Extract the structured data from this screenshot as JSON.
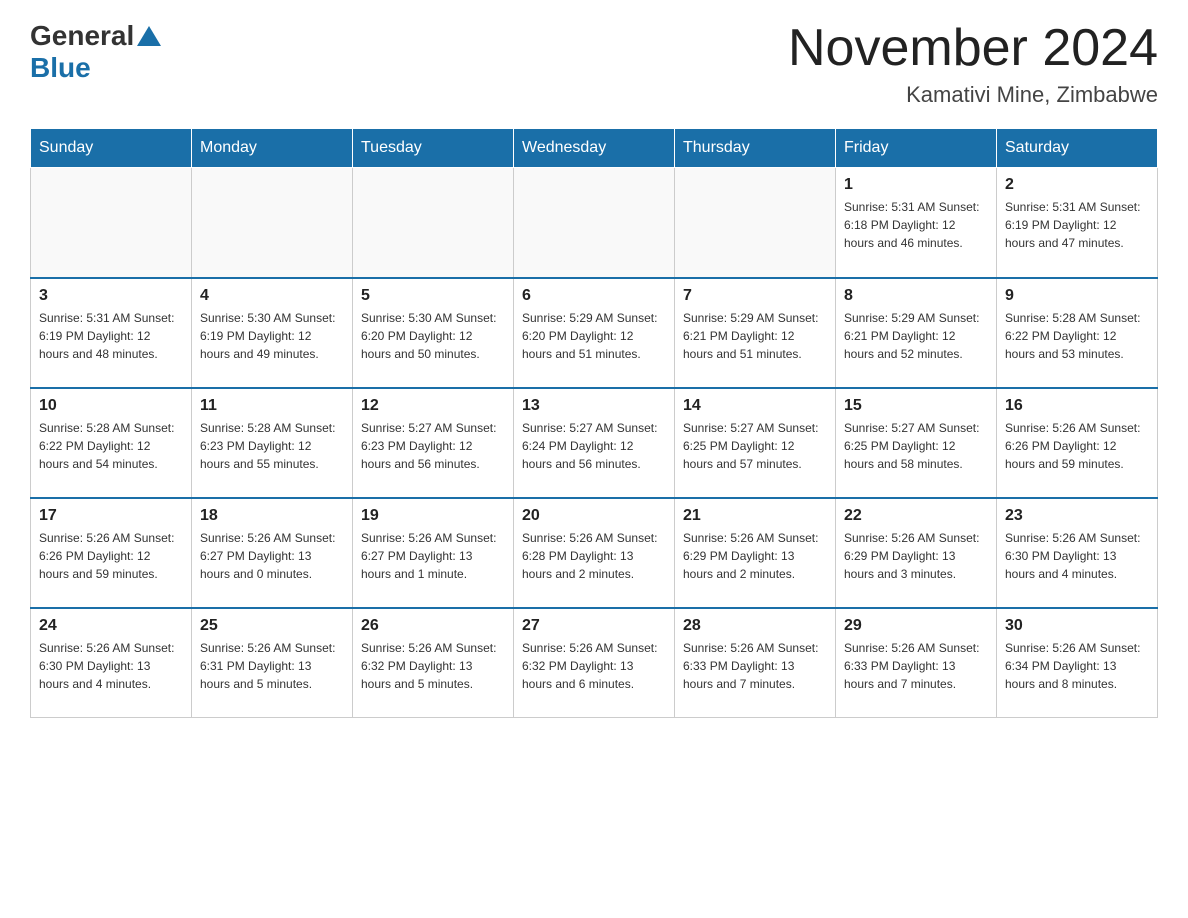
{
  "header": {
    "logo_general": "General",
    "logo_blue": "Blue",
    "month_title": "November 2024",
    "location": "Kamativi Mine, Zimbabwe"
  },
  "days_of_week": [
    "Sunday",
    "Monday",
    "Tuesday",
    "Wednesday",
    "Thursday",
    "Friday",
    "Saturday"
  ],
  "weeks": [
    [
      {
        "day": "",
        "info": ""
      },
      {
        "day": "",
        "info": ""
      },
      {
        "day": "",
        "info": ""
      },
      {
        "day": "",
        "info": ""
      },
      {
        "day": "",
        "info": ""
      },
      {
        "day": "1",
        "info": "Sunrise: 5:31 AM\nSunset: 6:18 PM\nDaylight: 12 hours\nand 46 minutes."
      },
      {
        "day": "2",
        "info": "Sunrise: 5:31 AM\nSunset: 6:19 PM\nDaylight: 12 hours\nand 47 minutes."
      }
    ],
    [
      {
        "day": "3",
        "info": "Sunrise: 5:31 AM\nSunset: 6:19 PM\nDaylight: 12 hours\nand 48 minutes."
      },
      {
        "day": "4",
        "info": "Sunrise: 5:30 AM\nSunset: 6:19 PM\nDaylight: 12 hours\nand 49 minutes."
      },
      {
        "day": "5",
        "info": "Sunrise: 5:30 AM\nSunset: 6:20 PM\nDaylight: 12 hours\nand 50 minutes."
      },
      {
        "day": "6",
        "info": "Sunrise: 5:29 AM\nSunset: 6:20 PM\nDaylight: 12 hours\nand 51 minutes."
      },
      {
        "day": "7",
        "info": "Sunrise: 5:29 AM\nSunset: 6:21 PM\nDaylight: 12 hours\nand 51 minutes."
      },
      {
        "day": "8",
        "info": "Sunrise: 5:29 AM\nSunset: 6:21 PM\nDaylight: 12 hours\nand 52 minutes."
      },
      {
        "day": "9",
        "info": "Sunrise: 5:28 AM\nSunset: 6:22 PM\nDaylight: 12 hours\nand 53 minutes."
      }
    ],
    [
      {
        "day": "10",
        "info": "Sunrise: 5:28 AM\nSunset: 6:22 PM\nDaylight: 12 hours\nand 54 minutes."
      },
      {
        "day": "11",
        "info": "Sunrise: 5:28 AM\nSunset: 6:23 PM\nDaylight: 12 hours\nand 55 minutes."
      },
      {
        "day": "12",
        "info": "Sunrise: 5:27 AM\nSunset: 6:23 PM\nDaylight: 12 hours\nand 56 minutes."
      },
      {
        "day": "13",
        "info": "Sunrise: 5:27 AM\nSunset: 6:24 PM\nDaylight: 12 hours\nand 56 minutes."
      },
      {
        "day": "14",
        "info": "Sunrise: 5:27 AM\nSunset: 6:25 PM\nDaylight: 12 hours\nand 57 minutes."
      },
      {
        "day": "15",
        "info": "Sunrise: 5:27 AM\nSunset: 6:25 PM\nDaylight: 12 hours\nand 58 minutes."
      },
      {
        "day": "16",
        "info": "Sunrise: 5:26 AM\nSunset: 6:26 PM\nDaylight: 12 hours\nand 59 minutes."
      }
    ],
    [
      {
        "day": "17",
        "info": "Sunrise: 5:26 AM\nSunset: 6:26 PM\nDaylight: 12 hours\nand 59 minutes."
      },
      {
        "day": "18",
        "info": "Sunrise: 5:26 AM\nSunset: 6:27 PM\nDaylight: 13 hours\nand 0 minutes."
      },
      {
        "day": "19",
        "info": "Sunrise: 5:26 AM\nSunset: 6:27 PM\nDaylight: 13 hours\nand 1 minute."
      },
      {
        "day": "20",
        "info": "Sunrise: 5:26 AM\nSunset: 6:28 PM\nDaylight: 13 hours\nand 2 minutes."
      },
      {
        "day": "21",
        "info": "Sunrise: 5:26 AM\nSunset: 6:29 PM\nDaylight: 13 hours\nand 2 minutes."
      },
      {
        "day": "22",
        "info": "Sunrise: 5:26 AM\nSunset: 6:29 PM\nDaylight: 13 hours\nand 3 minutes."
      },
      {
        "day": "23",
        "info": "Sunrise: 5:26 AM\nSunset: 6:30 PM\nDaylight: 13 hours\nand 4 minutes."
      }
    ],
    [
      {
        "day": "24",
        "info": "Sunrise: 5:26 AM\nSunset: 6:30 PM\nDaylight: 13 hours\nand 4 minutes."
      },
      {
        "day": "25",
        "info": "Sunrise: 5:26 AM\nSunset: 6:31 PM\nDaylight: 13 hours\nand 5 minutes."
      },
      {
        "day": "26",
        "info": "Sunrise: 5:26 AM\nSunset: 6:32 PM\nDaylight: 13 hours\nand 5 minutes."
      },
      {
        "day": "27",
        "info": "Sunrise: 5:26 AM\nSunset: 6:32 PM\nDaylight: 13 hours\nand 6 minutes."
      },
      {
        "day": "28",
        "info": "Sunrise: 5:26 AM\nSunset: 6:33 PM\nDaylight: 13 hours\nand 7 minutes."
      },
      {
        "day": "29",
        "info": "Sunrise: 5:26 AM\nSunset: 6:33 PM\nDaylight: 13 hours\nand 7 minutes."
      },
      {
        "day": "30",
        "info": "Sunrise: 5:26 AM\nSunset: 6:34 PM\nDaylight: 13 hours\nand 8 minutes."
      }
    ]
  ]
}
